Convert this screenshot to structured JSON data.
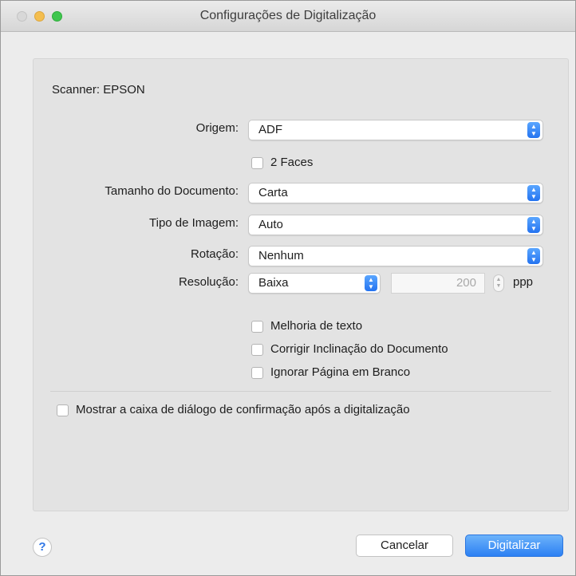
{
  "window": {
    "title": "Configurações de Digitalização"
  },
  "scanner": {
    "label": "Scanner: EPSON"
  },
  "settings": {
    "origem": {
      "label": "Origem:",
      "value": "ADF"
    },
    "two_faces": {
      "label": "2 Faces",
      "checked": false
    },
    "document_size": {
      "label": "Tamanho do Documento:",
      "value": "Carta"
    },
    "image_type": {
      "label": "Tipo de Imagem:",
      "value": "Auto"
    },
    "rotation": {
      "label": "Rotação:",
      "value": "Nenhum"
    },
    "resolution": {
      "label": "Resolução:",
      "value": "Baixa",
      "dpi": "200",
      "unit": "ppp"
    }
  },
  "options": {
    "text_enhance": {
      "label": "Melhoria de texto",
      "checked": false
    },
    "deskew": {
      "label": "Corrigir Inclinação do Documento",
      "checked": false
    },
    "skip_blank": {
      "label": "Ignorar Página em Branco",
      "checked": false
    }
  },
  "confirm": {
    "label": "Mostrar a caixa de diálogo de confirmação após a digitalização",
    "checked": false
  },
  "footer": {
    "help_icon": "?",
    "cancel_label": "Cancelar",
    "scan_label": "Digitalizar"
  },
  "icons": {
    "popup_arrows": "updown-chevron-icon",
    "help": "question-mark-icon"
  },
  "colors": {
    "accent": "#2c80f3",
    "close_button": "#d8d8d8",
    "minimize_button": "#f4be4f",
    "zoom_button": "#3fc64e"
  }
}
